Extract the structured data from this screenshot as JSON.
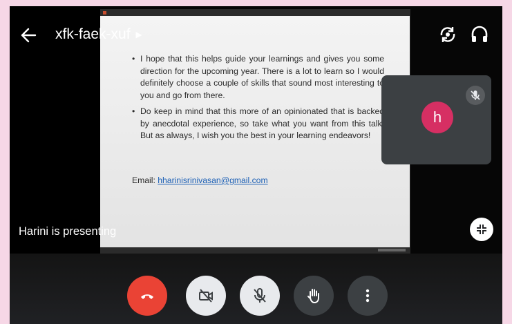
{
  "meeting": {
    "code": "xfk-faek-xuf",
    "presenting_text": "Harini is presenting"
  },
  "slide": {
    "bullets": [
      "I hope that this helps guide your learnings and gives you some direction for the upcoming year. There is a lot to learn so I would definitely choose a couple of skills that sound most interesting to you and go from there.",
      "Do keep in mind that this more of an opinionated that is backed by anecdotal experience, so take what you want from this talk. But as always, I wish you the best in your learning endeavors!"
    ],
    "email_label": "Email: ",
    "email_address": "hharinisrinivasan@gmail.com"
  },
  "self_tile": {
    "avatar_letter": "h",
    "avatar_color": "#d62f63"
  },
  "controls": {
    "end_call_color": "#ea4335",
    "buttons": [
      "end-call",
      "camera-off",
      "mic-off",
      "raise-hand",
      "more-options"
    ]
  },
  "icons": {
    "back": "arrow-left-icon",
    "switch_camera": "switch-camera-icon",
    "audio": "headphones-icon",
    "minimize": "collapse-icon"
  }
}
